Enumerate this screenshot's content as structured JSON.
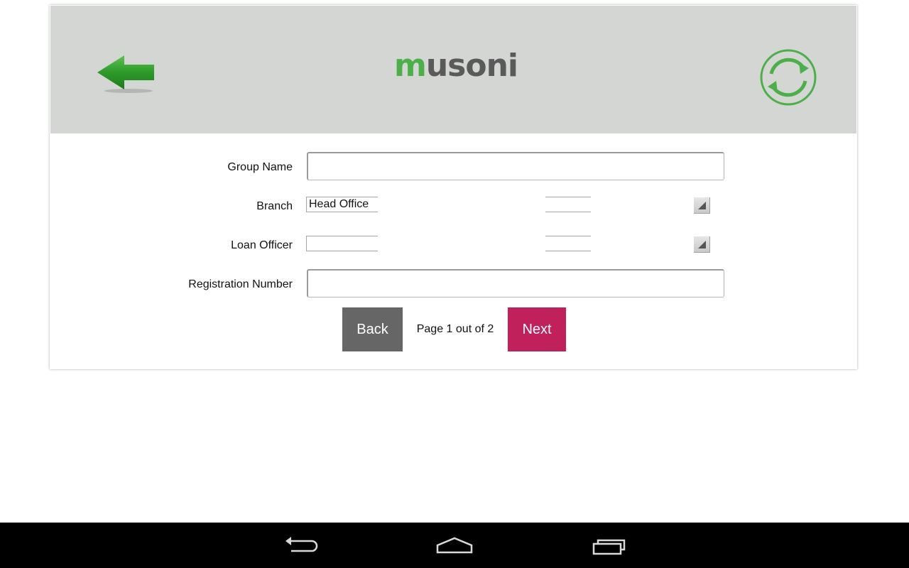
{
  "header": {
    "logo_first": "m",
    "logo_rest": "usoni",
    "back_icon": "back-arrow-icon",
    "refresh_icon": "refresh-icon"
  },
  "form": {
    "group_name_label": "Group Name",
    "group_name_value": "",
    "branch_label": "Branch",
    "branch_value": "Head Office",
    "loan_officer_label": "Loan Officer",
    "loan_officer_value": "",
    "registration_number_label": "Registration Number",
    "registration_number_value": ""
  },
  "pager": {
    "back_label": "Back",
    "page_text": "Page 1 out of 2",
    "next_label": "Next"
  },
  "colors": {
    "header_bg": "#d4d6d3",
    "brand_green": "#4daf4a",
    "next_button": "#c0215b",
    "back_button": "#666666"
  }
}
